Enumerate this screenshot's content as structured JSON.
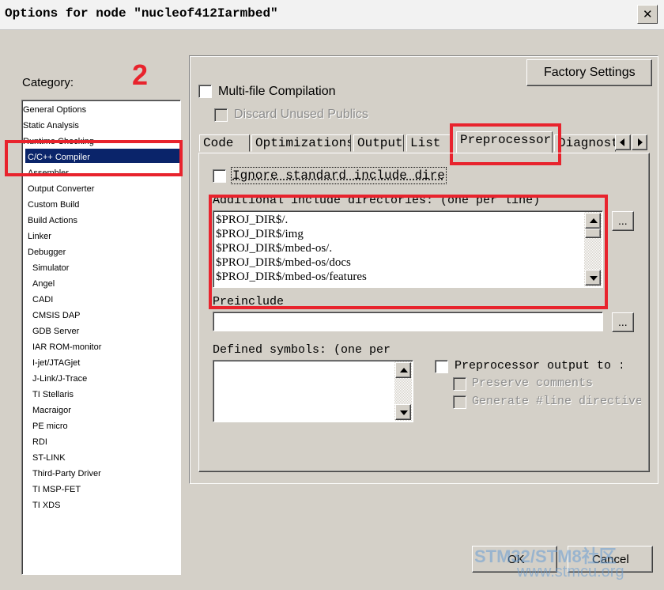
{
  "window": {
    "title": "Options for node \"nucleof412Iarmbed\"",
    "close_glyph": "✕"
  },
  "category": {
    "label": "Category:",
    "annotation_number": "2",
    "items": [
      "General Options",
      "Static Analysis",
      "Runtime Checking",
      "C/C++ Compiler",
      "Assembler",
      "Output Converter",
      "Custom Build",
      "Build Actions",
      "Linker",
      "Debugger",
      "Simulator",
      "Angel",
      "CADI",
      "CMSIS DAP",
      "GDB Server",
      "IAR ROM-monitor",
      "I-jet/JTAGjet",
      "J-Link/J-Trace",
      "TI Stellaris",
      "Macraigor",
      "PE micro",
      "RDI",
      "ST-LINK",
      "Third-Party Driver",
      "TI MSP-FET",
      "TI XDS"
    ],
    "selected": "C/C++ Compiler"
  },
  "factory_settings_label": "Factory Settings",
  "multi_file": {
    "label": "Multi-file Compilation",
    "checked": false
  },
  "discard_unused": {
    "label": "Discard Unused Publics",
    "checked": false
  },
  "tabs": [
    "Code",
    "Optimizations",
    "Output",
    "List",
    "Preprocessor",
    "Diagnost"
  ],
  "active_tab": "Preprocessor",
  "preprocessor": {
    "ignore_std_label": "Ignore standard include dire",
    "ignore_std_checked": false,
    "include_dirs_label": "Additional include directories: (one per line)",
    "include_dirs": [
      "$PROJ_DIR$/.",
      "$PROJ_DIR$/img",
      "$PROJ_DIR$/mbed-os/.",
      "$PROJ_DIR$/mbed-os/docs",
      "$PROJ_DIR$/mbed-os/features"
    ],
    "browse_label": "...",
    "preinclude_label": "Preinclude",
    "preinclude_value": "",
    "defined_symbols_label": "Defined symbols: (one per",
    "pp_output_label": "Preprocessor output to :",
    "preserve_comments_label": "Preserve comments",
    "generate_line_label": "Generate #line directive"
  },
  "ok_label": "OK",
  "cancel_label": "Cancel",
  "watermark": {
    "text": "STM32/STM8社区",
    "url": "www.stmcu.org"
  }
}
